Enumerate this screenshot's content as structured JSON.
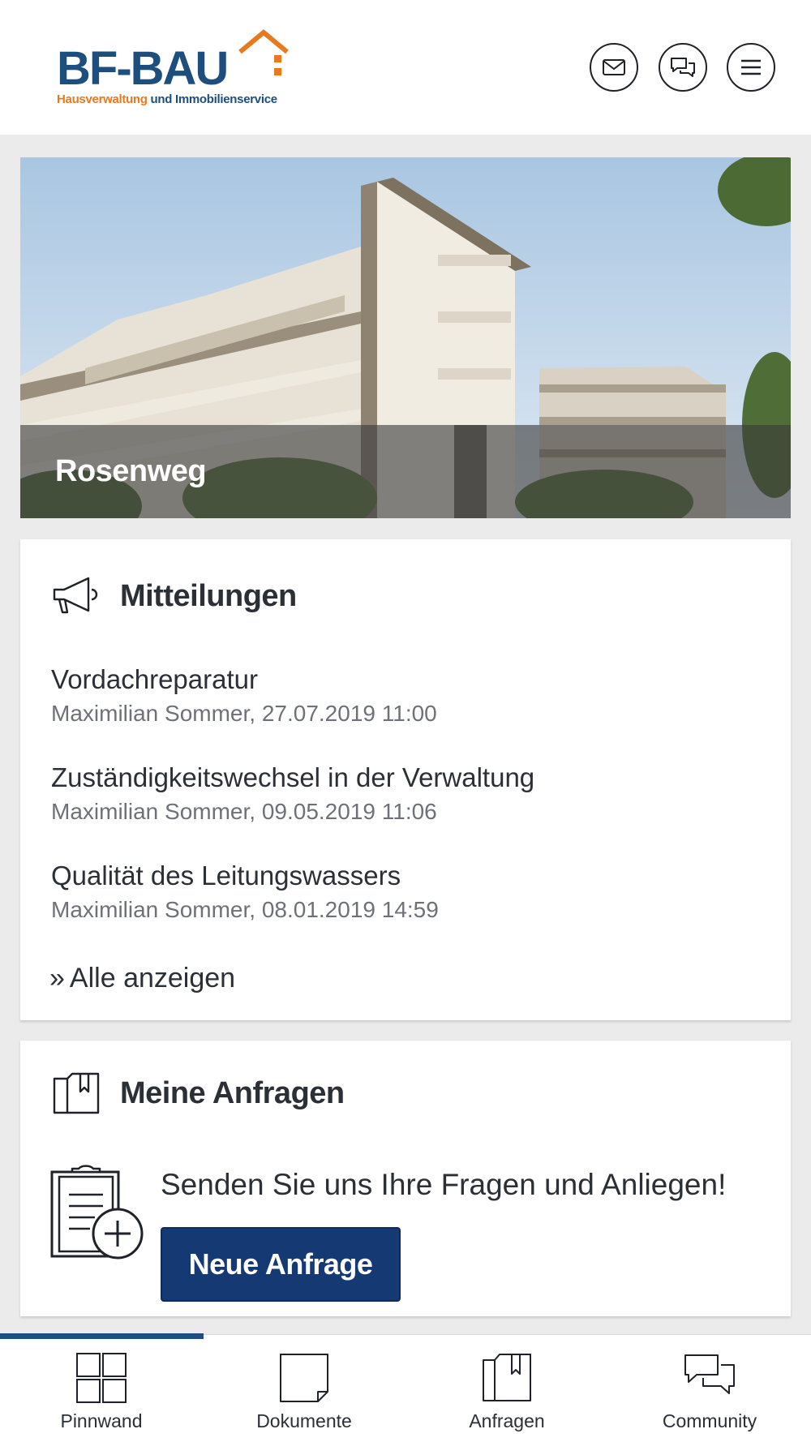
{
  "header": {
    "logo_text": "BF-BAU",
    "logo_sub_a": "Hausverwaltung",
    "logo_sub_b": " und Immobilienservice",
    "icons": [
      "mail-icon",
      "chat-icon",
      "menu-icon"
    ]
  },
  "hero": {
    "title": "Rosenweg"
  },
  "messages": {
    "title": "Mitteilungen",
    "icon": "megaphone-icon",
    "items": [
      {
        "title": "Vordachreparatur",
        "meta": "Maximilian Sommer, 27.07.2019 11:00"
      },
      {
        "title": "Zuständigkeitswechsel in der Verwaltung",
        "meta": "Maximilian Sommer, 09.05.2019 11:06"
      },
      {
        "title": "Qualität des Leitungswassers",
        "meta": "Maximilian Sommer, 08.01.2019 14:59"
      }
    ],
    "all_link_chev": "»",
    "all_link": "Alle anzeigen"
  },
  "requests": {
    "title": "Meine Anfragen",
    "icon": "folder-icon",
    "text": "Senden Sie uns Ihre Fragen und Anliegen!",
    "button": "Neue Anfrage"
  },
  "nav": {
    "items": [
      {
        "label": "Pinnwand",
        "icon": "grid-icon",
        "active": true
      },
      {
        "label": "Dokumente",
        "icon": "document-icon",
        "active": false
      },
      {
        "label": "Anfragen",
        "icon": "folder-icon",
        "active": false
      },
      {
        "label": "Community",
        "icon": "chat-icon",
        "active": false
      }
    ]
  },
  "colors": {
    "brand_blue": "#1d4e7d",
    "brand_orange": "#e8791f",
    "button_blue": "#153a73",
    "background": "#ebebeb"
  }
}
